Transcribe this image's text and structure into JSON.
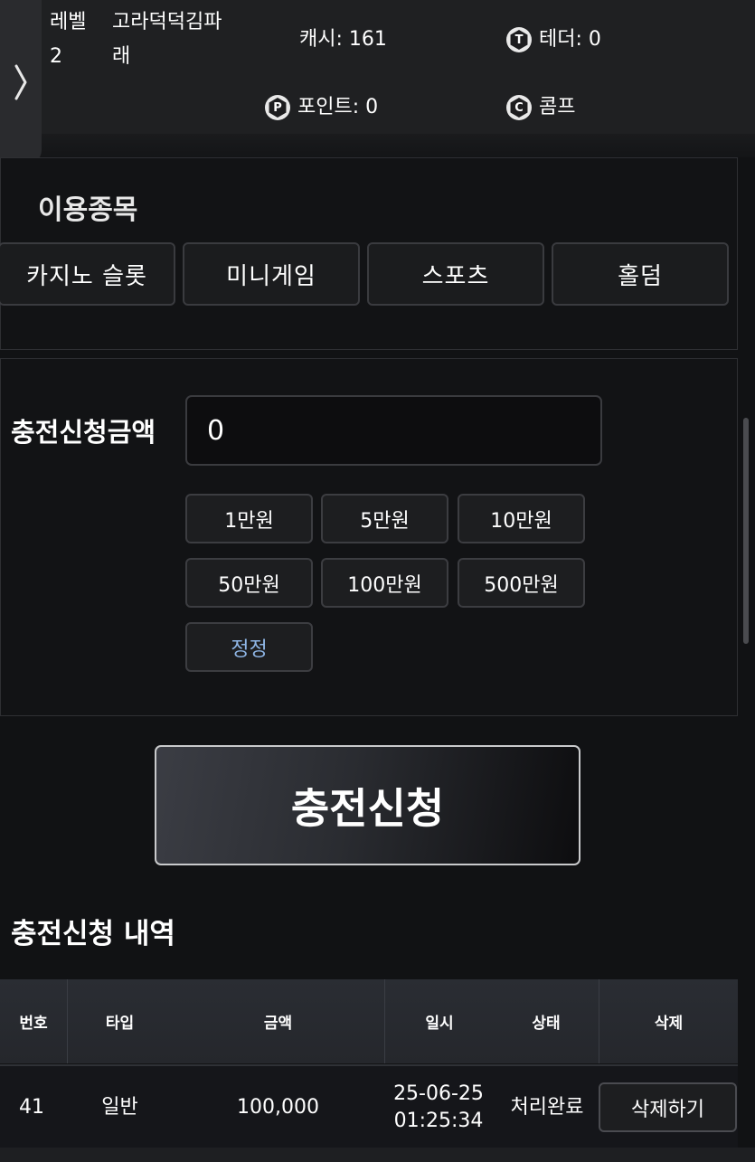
{
  "header": {
    "level_label": "레벨",
    "level_value": "2",
    "username_line1": "고라덕덕김파",
    "username_line2": "래",
    "cash": "캐시: 161",
    "tether": "테더: 0",
    "points": "포인트: 0",
    "comp": "콤프",
    "icons": {
      "tether": "T",
      "points": "P",
      "comp": "C"
    }
  },
  "games": {
    "title": "이용종목",
    "items": [
      "카지노 슬롯",
      "미니게임",
      "스포츠",
      "홀덤"
    ]
  },
  "deposit": {
    "label": "충전신청금액",
    "input_value": "0",
    "quick_amounts": [
      "1만원",
      "5만원",
      "10만원",
      "50만원",
      "100만원",
      "500만원"
    ],
    "reset_label": "정정",
    "submit_label": "충전신청"
  },
  "history": {
    "title": "충전신청 내역",
    "columns": [
      "번호",
      "타입",
      "금액",
      "일시",
      "상태",
      "삭제"
    ],
    "rows": [
      {
        "number": "41",
        "type": "일반",
        "amount": "100,000",
        "date": "25-06-25",
        "time": "01:25:34",
        "status": "처리완료",
        "delete_label": "삭제하기"
      }
    ]
  }
}
